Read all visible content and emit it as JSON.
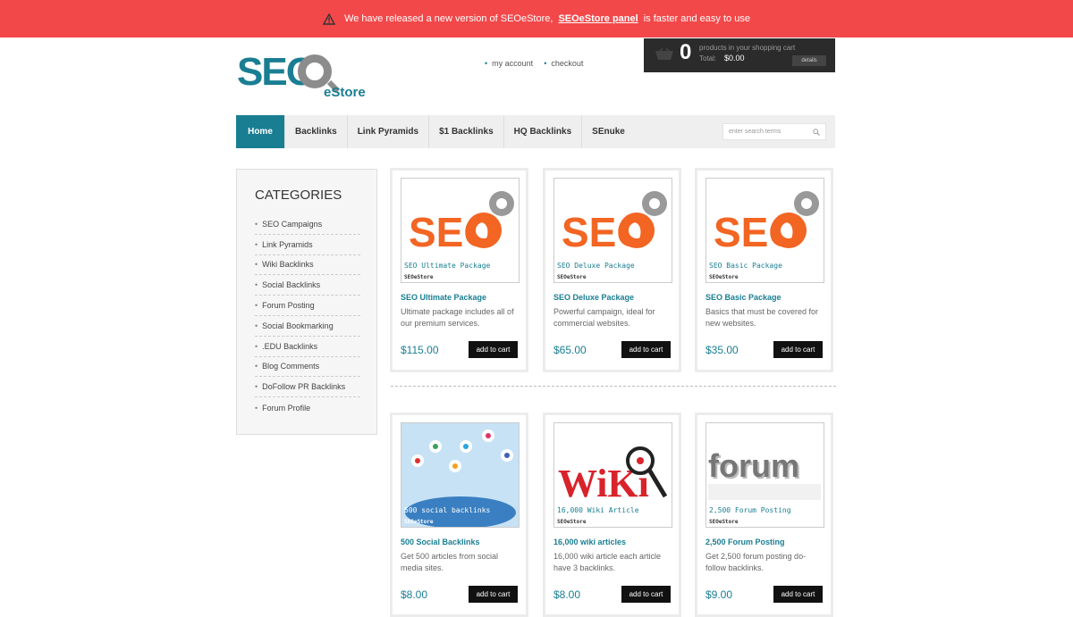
{
  "banner": {
    "text_before": "We have released a new version of SEOeStore,",
    "link": "SEOeStore panel",
    "text_after": "is faster and easy to use"
  },
  "logo": {
    "main": "SEO",
    "sub": "eStore"
  },
  "top_links": {
    "account": "my account",
    "checkout": "checkout"
  },
  "cart": {
    "count": "0",
    "label": "products in your shopping cart",
    "total_label": "Total:",
    "total": "$0.00",
    "details": "details"
  },
  "nav": {
    "items": [
      "Home",
      "Backlinks",
      "Link Pyramids",
      "$1 Backlinks",
      "HQ Backlinks",
      "SEnuke"
    ],
    "search_placeholder": "enter search terms"
  },
  "categories": {
    "title": "CATEGORIES",
    "items": [
      "SEO Campaigns",
      "Link Pyramids",
      "Wiki Backlinks",
      "Social Backlinks",
      "Forum Posting",
      "Social Bookmarking",
      ".EDU Backlinks",
      "Blog Comments",
      "DoFollow PR Backlinks",
      "Forum Profile"
    ]
  },
  "products": [
    {
      "title": "SEO Ultimate Package",
      "desc": "Ultimate package includes all of our premium services.",
      "price": "$115.00",
      "button": "add to cart",
      "img_caption": "SEO Ultimate Package",
      "img_brand": "SEOeStore"
    },
    {
      "title": "SEO Deluxe Package",
      "desc": "Powerful campaign, ideal for commercial websites.",
      "price": "$65.00",
      "button": "add to cart",
      "img_caption": "SEO Deluxe Package",
      "img_brand": "SEOeStore"
    },
    {
      "title": "SEO Basic Package",
      "desc": "Basics that must be covered for new websites.",
      "price": "$35.00",
      "button": "add to cart",
      "img_caption": "SEO Basic Package",
      "img_brand": "SEOeStore"
    },
    {
      "title": "500 Social Backlinks",
      "desc": "Get 500 articles from social media sites.",
      "price": "$8.00",
      "button": "add to cart",
      "img_caption": "500 social backlinks",
      "img_brand": "SEOeStore"
    },
    {
      "title": "16,000 wiki articles",
      "desc": "16,000 wiki article each article have 3 backlinks.",
      "price": "$8.00",
      "button": "add to cart",
      "img_caption": "16,000 Wiki Article",
      "img_brand": "SEOeStore"
    },
    {
      "title": "2,500 Forum Posting",
      "desc": "Get 2,500 forum posting do-follow backlinks.",
      "price": "$9.00",
      "button": "add to cart",
      "img_caption": "2,500 Forum Posting",
      "img_brand": "SEOeStore"
    }
  ],
  "image_art": {
    "seo_word": "SEO",
    "wiki_word": "WiKi",
    "forum_word": "forum"
  },
  "colors": {
    "banner": "#f2484a",
    "accent": "#1a7e93",
    "seo_orange": "#f26522"
  }
}
